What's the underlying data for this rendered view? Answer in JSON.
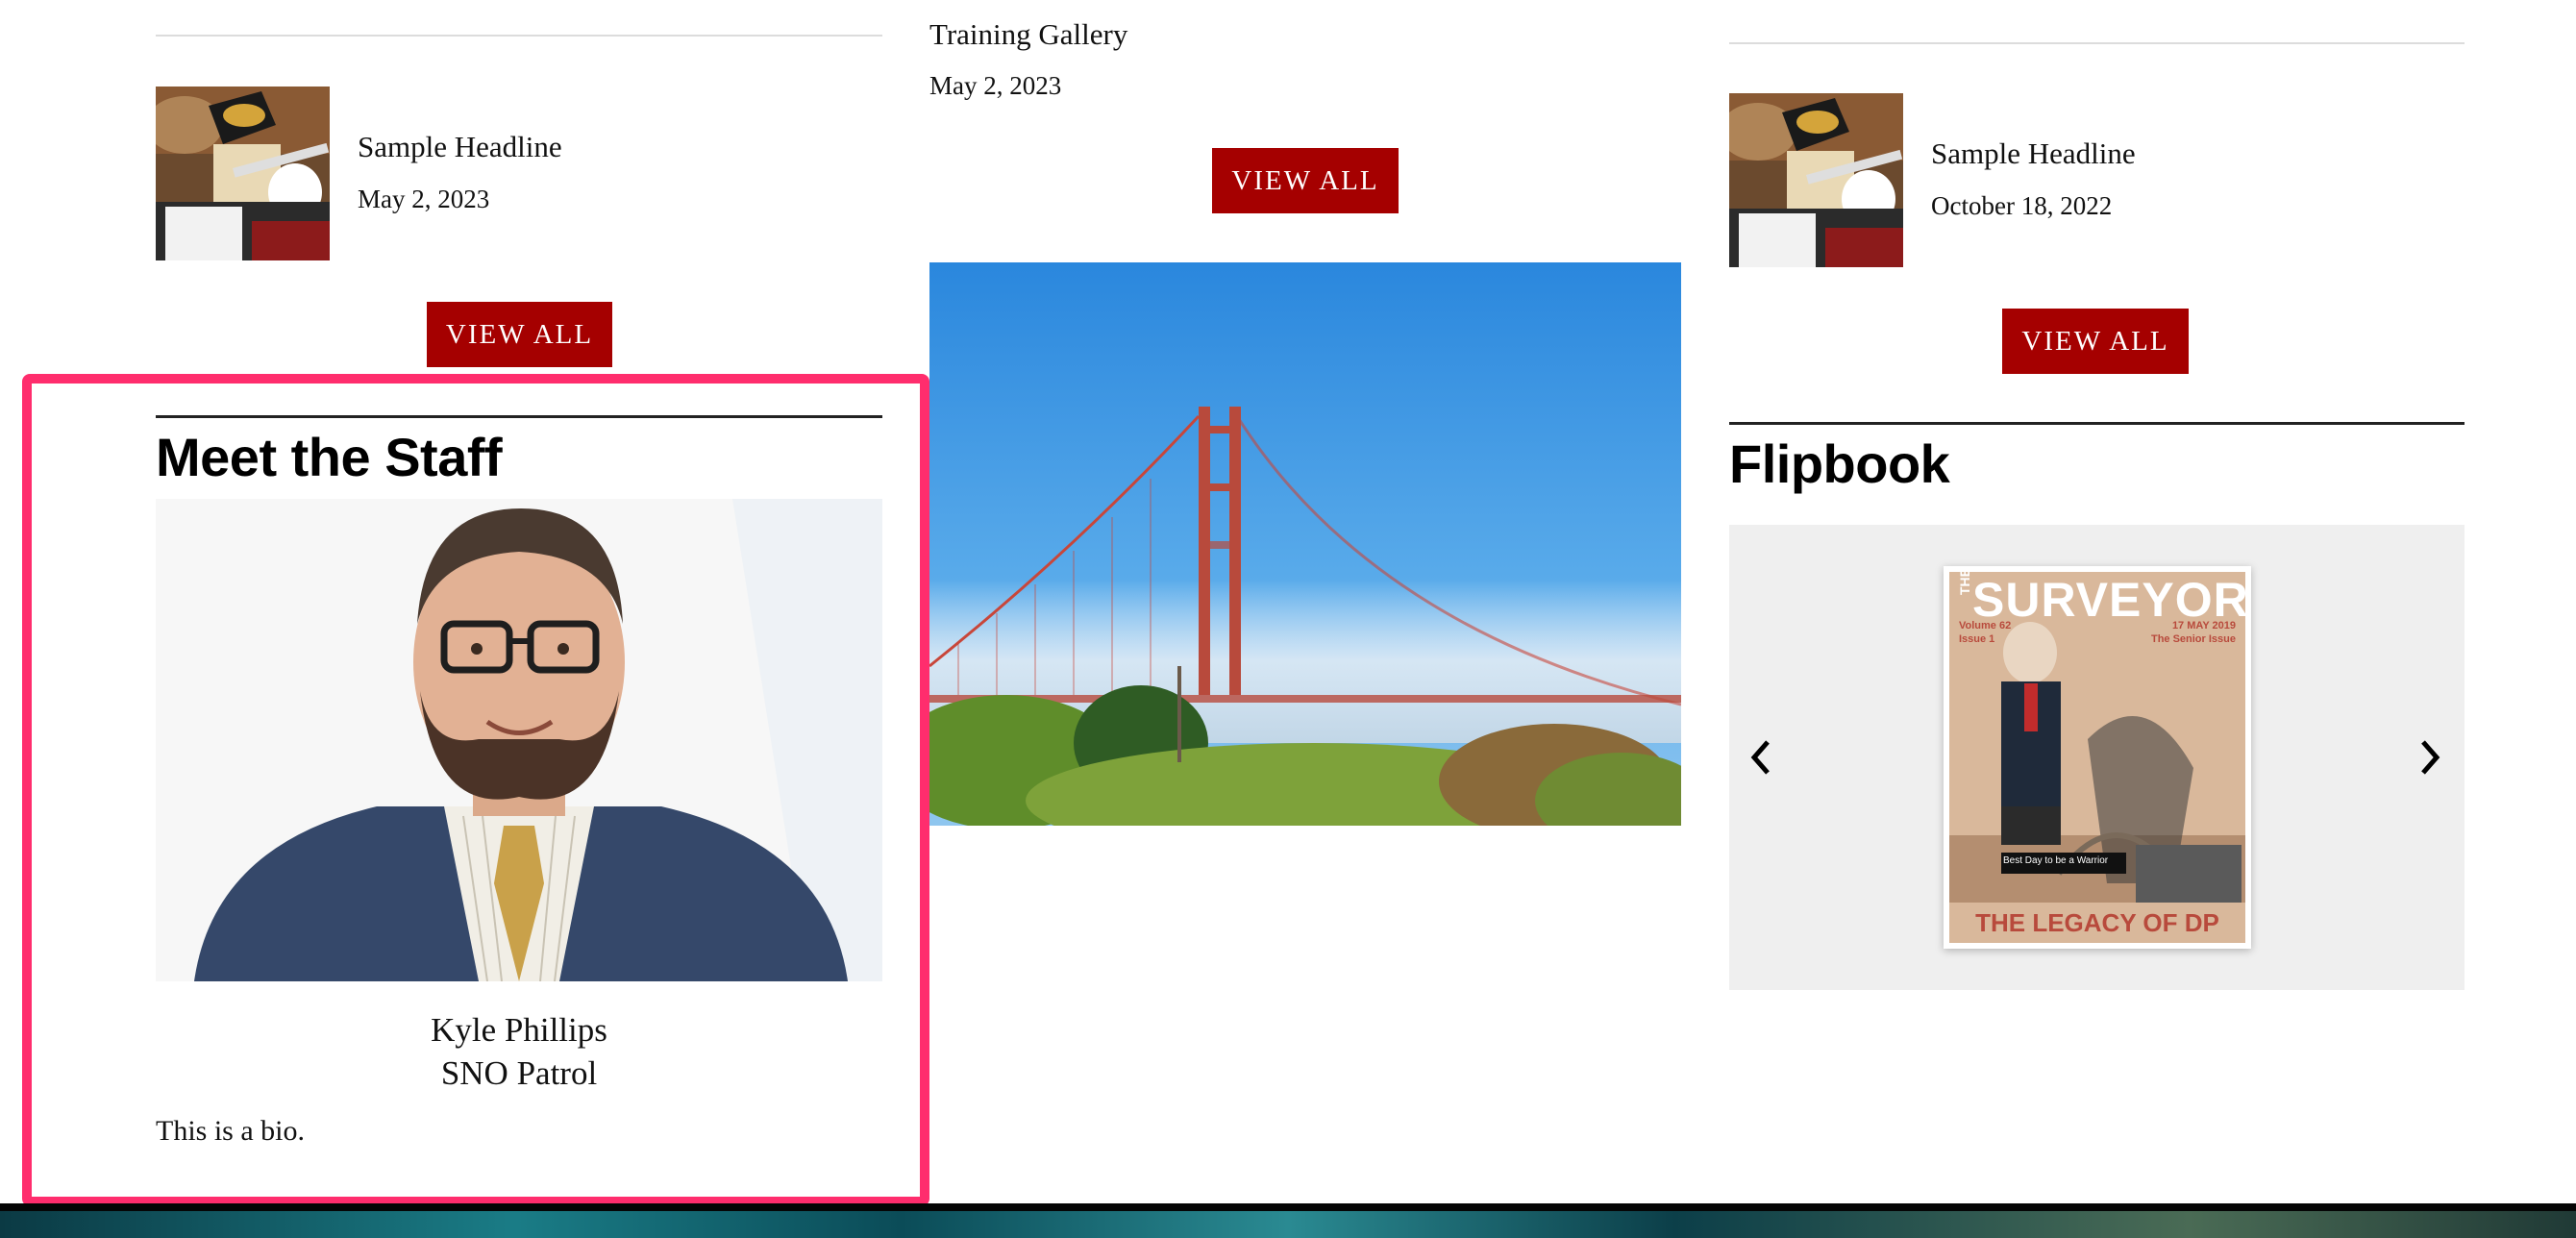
{
  "col1": {
    "headline": "Sample Headline",
    "date": "May 2, 2023",
    "view_all": "VIEW ALL"
  },
  "col2": {
    "gallery_title": "Training Gallery",
    "date": "May 2, 2023",
    "view_all": "VIEW ALL"
  },
  "col3": {
    "headline": "Sample Headline",
    "date": "October 18, 2022",
    "view_all": "VIEW ALL"
  },
  "staff": {
    "title": "Meet the Staff",
    "name": "Kyle Phillips",
    "role": "SNO Patrol",
    "bio": "This is a bio."
  },
  "flipbook": {
    "title": "Flipbook",
    "cover": {
      "masthead_small": "THE",
      "masthead": "SURVEYOR",
      "volume": "Volume 62",
      "issue": "Issue 1",
      "date": "17 MAY 2019",
      "issue_name": "The Senior Issue",
      "headline": "THE LEGACY OF DP",
      "sign": "Best Day to be a Warrior"
    }
  },
  "colors": {
    "accent": "#a50000",
    "highlight": "#ff2d6d",
    "panel": "#efefef"
  }
}
